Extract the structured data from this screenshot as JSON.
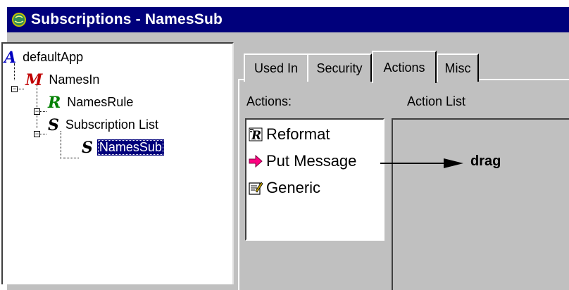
{
  "window": {
    "title": "Subscriptions - NamesSub"
  },
  "tree": {
    "nodes": [
      {
        "icon": "app-icon",
        "glyph": "A",
        "label": "defaultApp"
      },
      {
        "icon": "message-flow-icon",
        "glyph": "M",
        "label": "NamesIn"
      },
      {
        "icon": "rule-icon",
        "glyph": "R",
        "label": "NamesRule"
      },
      {
        "icon": "subscription-list-icon",
        "glyph": "S",
        "label": "Subscription List"
      },
      {
        "icon": "subscription-icon",
        "glyph": "S",
        "label": "NamesSub",
        "selected": true
      }
    ]
  },
  "tabs": [
    {
      "label": "Used In"
    },
    {
      "label": "Security"
    },
    {
      "label": "Actions",
      "active": true
    },
    {
      "label": "Misc"
    }
  ],
  "actions_panel": {
    "actions_label": "Actions:",
    "action_list_label": "Action List",
    "items": [
      {
        "icon": "reformat-icon",
        "label": "Reformat"
      },
      {
        "icon": "put-message-icon",
        "label": "Put Message"
      },
      {
        "icon": "generic-icon",
        "label": "Generic"
      }
    ]
  },
  "annotation": {
    "drag_label": "drag"
  },
  "colors": {
    "titlebar": "#00007b",
    "face": "#c0c0c0",
    "selection": "#00007b",
    "glyph_app": "#0000c0",
    "glyph_flow": "#c00000",
    "glyph_rule": "#008000",
    "glyph_sub": "#000000",
    "put_message_arrow": "#ff0080"
  }
}
